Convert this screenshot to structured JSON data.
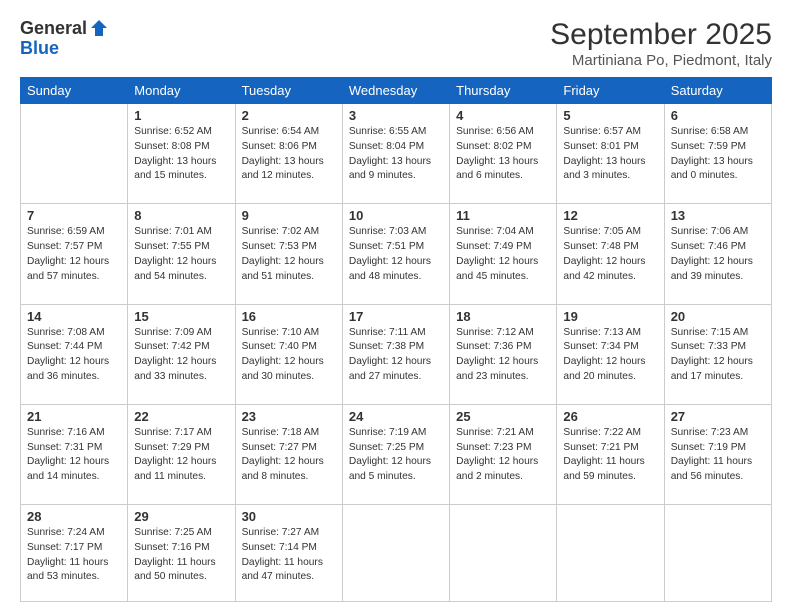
{
  "logo": {
    "general": "General",
    "blue": "Blue"
  },
  "title": "September 2025",
  "subtitle": "Martiniana Po, Piedmont, Italy",
  "weekdays": [
    "Sunday",
    "Monday",
    "Tuesday",
    "Wednesday",
    "Thursday",
    "Friday",
    "Saturday"
  ],
  "weeks": [
    [
      {
        "day": "",
        "info": ""
      },
      {
        "day": "1",
        "info": "Sunrise: 6:52 AM\nSunset: 8:08 PM\nDaylight: 13 hours\nand 15 minutes."
      },
      {
        "day": "2",
        "info": "Sunrise: 6:54 AM\nSunset: 8:06 PM\nDaylight: 13 hours\nand 12 minutes."
      },
      {
        "day": "3",
        "info": "Sunrise: 6:55 AM\nSunset: 8:04 PM\nDaylight: 13 hours\nand 9 minutes."
      },
      {
        "day": "4",
        "info": "Sunrise: 6:56 AM\nSunset: 8:02 PM\nDaylight: 13 hours\nand 6 minutes."
      },
      {
        "day": "5",
        "info": "Sunrise: 6:57 AM\nSunset: 8:01 PM\nDaylight: 13 hours\nand 3 minutes."
      },
      {
        "day": "6",
        "info": "Sunrise: 6:58 AM\nSunset: 7:59 PM\nDaylight: 13 hours\nand 0 minutes."
      }
    ],
    [
      {
        "day": "7",
        "info": "Sunrise: 6:59 AM\nSunset: 7:57 PM\nDaylight: 12 hours\nand 57 minutes."
      },
      {
        "day": "8",
        "info": "Sunrise: 7:01 AM\nSunset: 7:55 PM\nDaylight: 12 hours\nand 54 minutes."
      },
      {
        "day": "9",
        "info": "Sunrise: 7:02 AM\nSunset: 7:53 PM\nDaylight: 12 hours\nand 51 minutes."
      },
      {
        "day": "10",
        "info": "Sunrise: 7:03 AM\nSunset: 7:51 PM\nDaylight: 12 hours\nand 48 minutes."
      },
      {
        "day": "11",
        "info": "Sunrise: 7:04 AM\nSunset: 7:49 PM\nDaylight: 12 hours\nand 45 minutes."
      },
      {
        "day": "12",
        "info": "Sunrise: 7:05 AM\nSunset: 7:48 PM\nDaylight: 12 hours\nand 42 minutes."
      },
      {
        "day": "13",
        "info": "Sunrise: 7:06 AM\nSunset: 7:46 PM\nDaylight: 12 hours\nand 39 minutes."
      }
    ],
    [
      {
        "day": "14",
        "info": "Sunrise: 7:08 AM\nSunset: 7:44 PM\nDaylight: 12 hours\nand 36 minutes."
      },
      {
        "day": "15",
        "info": "Sunrise: 7:09 AM\nSunset: 7:42 PM\nDaylight: 12 hours\nand 33 minutes."
      },
      {
        "day": "16",
        "info": "Sunrise: 7:10 AM\nSunset: 7:40 PM\nDaylight: 12 hours\nand 30 minutes."
      },
      {
        "day": "17",
        "info": "Sunrise: 7:11 AM\nSunset: 7:38 PM\nDaylight: 12 hours\nand 27 minutes."
      },
      {
        "day": "18",
        "info": "Sunrise: 7:12 AM\nSunset: 7:36 PM\nDaylight: 12 hours\nand 23 minutes."
      },
      {
        "day": "19",
        "info": "Sunrise: 7:13 AM\nSunset: 7:34 PM\nDaylight: 12 hours\nand 20 minutes."
      },
      {
        "day": "20",
        "info": "Sunrise: 7:15 AM\nSunset: 7:33 PM\nDaylight: 12 hours\nand 17 minutes."
      }
    ],
    [
      {
        "day": "21",
        "info": "Sunrise: 7:16 AM\nSunset: 7:31 PM\nDaylight: 12 hours\nand 14 minutes."
      },
      {
        "day": "22",
        "info": "Sunrise: 7:17 AM\nSunset: 7:29 PM\nDaylight: 12 hours\nand 11 minutes."
      },
      {
        "day": "23",
        "info": "Sunrise: 7:18 AM\nSunset: 7:27 PM\nDaylight: 12 hours\nand 8 minutes."
      },
      {
        "day": "24",
        "info": "Sunrise: 7:19 AM\nSunset: 7:25 PM\nDaylight: 12 hours\nand 5 minutes."
      },
      {
        "day": "25",
        "info": "Sunrise: 7:21 AM\nSunset: 7:23 PM\nDaylight: 12 hours\nand 2 minutes."
      },
      {
        "day": "26",
        "info": "Sunrise: 7:22 AM\nSunset: 7:21 PM\nDaylight: 11 hours\nand 59 minutes."
      },
      {
        "day": "27",
        "info": "Sunrise: 7:23 AM\nSunset: 7:19 PM\nDaylight: 11 hours\nand 56 minutes."
      }
    ],
    [
      {
        "day": "28",
        "info": "Sunrise: 7:24 AM\nSunset: 7:17 PM\nDaylight: 11 hours\nand 53 minutes."
      },
      {
        "day": "29",
        "info": "Sunrise: 7:25 AM\nSunset: 7:16 PM\nDaylight: 11 hours\nand 50 minutes."
      },
      {
        "day": "30",
        "info": "Sunrise: 7:27 AM\nSunset: 7:14 PM\nDaylight: 11 hours\nand 47 minutes."
      },
      {
        "day": "",
        "info": ""
      },
      {
        "day": "",
        "info": ""
      },
      {
        "day": "",
        "info": ""
      },
      {
        "day": "",
        "info": ""
      }
    ]
  ]
}
